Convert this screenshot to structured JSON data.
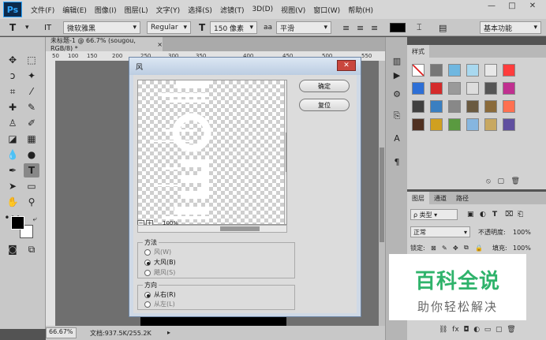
{
  "app": {
    "logo": "Ps"
  },
  "menu": [
    "文件(F)",
    "编辑(E)",
    "图像(I)",
    "图层(L)",
    "文字(Y)",
    "选择(S)",
    "滤镜(T)",
    "3D(D)",
    "视图(V)",
    "窗口(W)",
    "帮助(H)"
  ],
  "window_controls": {
    "minimize": "—",
    "restore": "□",
    "close": "✕"
  },
  "options": {
    "tool_glyph": "T",
    "orientation_glyph": "IT",
    "font_family": "微软雅黑",
    "font_style": "Regular",
    "size_glyph": "T",
    "font_size": "150 像素",
    "aa_glyph": "aa",
    "antialias": "平滑",
    "workspace": "基本功能",
    "text_color": "#000000"
  },
  "document": {
    "tab_title": "未标题-1 @ 66.7% (sougou, RGB/8) *",
    "tab_close": "×",
    "ruler_ticks": [
      "50",
      "100",
      "150",
      "200",
      "250",
      "300",
      "350",
      "400",
      "450",
      "500",
      "550"
    ],
    "zoom": "66.67%",
    "doc_info": "文档:937.5K/255.2K"
  },
  "panels": {
    "styles_tab": "样式",
    "layers_tabs": [
      "图层",
      "通道",
      "路径"
    ],
    "layer_filter": "ρ 类型",
    "blend_mode": "正常",
    "opacity_label": "不透明度:",
    "opacity": "100%",
    "lock_label": "锁定:",
    "fill_label": "填充:",
    "fill": "100%"
  },
  "watermark": {
    "title": "百科全说",
    "subtitle": "助你轻松解决"
  },
  "dialog": {
    "title": "风",
    "close_glyph": "✕",
    "ok": "确定",
    "reset": "复位",
    "zoom": "100%",
    "method": {
      "legend": "方法",
      "options": [
        "风(W)",
        "大风(B)",
        "飓风(S)"
      ],
      "selected": "大风(B)"
    },
    "direction": {
      "legend": "方向",
      "options": [
        "从右(R)",
        "从左(L)"
      ],
      "selected": "从右(R)"
    }
  }
}
